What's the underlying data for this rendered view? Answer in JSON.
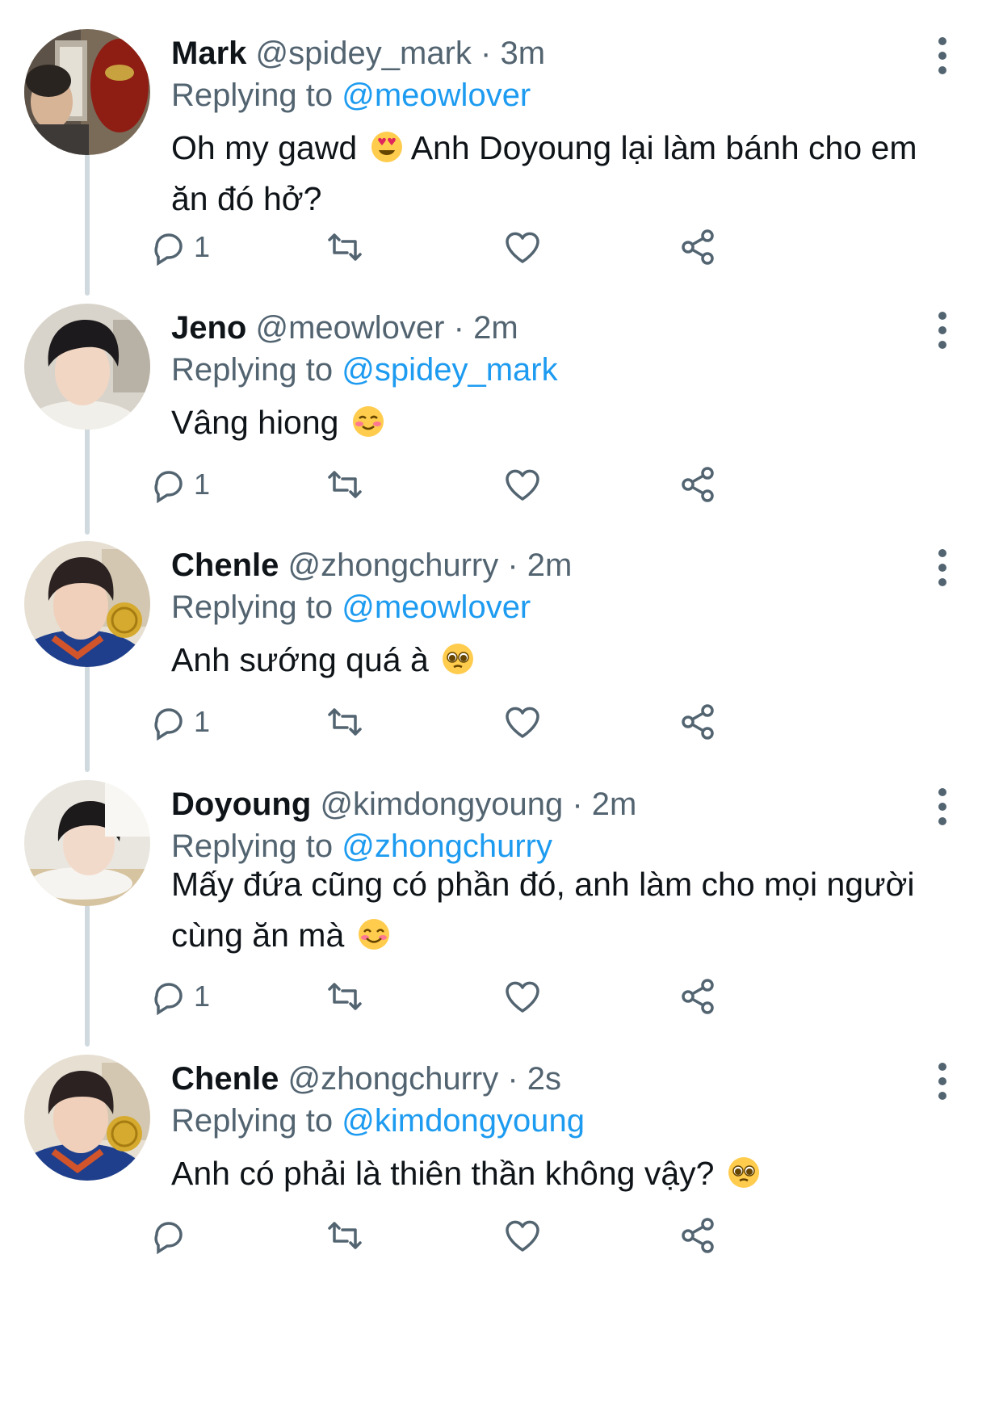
{
  "tweets": [
    {
      "name": "Mark",
      "handle": "@spidey_mark",
      "time": "3m",
      "replying_label": "Replying to",
      "replying_to": "@meowlover",
      "text": "Oh my gawd",
      "emoji": "heart-eyes",
      "text_after": "Anh Doyoung lại làm bánh cho em ăn đó hở?",
      "reply_count": "1"
    },
    {
      "name": "Jeno",
      "handle": "@meowlover",
      "time": "2m",
      "replying_label": "Replying to",
      "replying_to": "@spidey_mark",
      "text": "Vâng hiong",
      "emoji": "smiling-blush",
      "text_after": "",
      "reply_count": "1"
    },
    {
      "name": "Chenle",
      "handle": "@zhongchurry",
      "time": "2m",
      "replying_label": "Replying to",
      "replying_to": "@meowlover",
      "text": "Anh sướng quá à",
      "emoji": "pleading",
      "text_after": "",
      "reply_count": "1"
    },
    {
      "name": "Doyoung",
      "handle": "@kimdongyoung",
      "time": "2m",
      "replying_label": "Replying to",
      "replying_to": "@zhongchurry",
      "text": "Mấy đứa cũng có phần đó, anh làm cho mọi người cùng ăn mà",
      "emoji": "smiling",
      "text_after": "",
      "reply_count": "1"
    },
    {
      "name": "Chenle",
      "handle": "@zhongchurry",
      "time": "2s",
      "replying_label": "Replying to",
      "replying_to": "@kimdongyoung",
      "text": "Anh có phải là thiên thần không vậy?",
      "emoji": "pleading",
      "text_after": "",
      "reply_count": ""
    }
  ],
  "sep": "·",
  "colors": {
    "mention": "#1d9bf0",
    "muted": "#536471",
    "thread_line": "#cfd9de"
  },
  "icons": {
    "reply": "comment-bubble-icon",
    "retweet": "retweet-icon",
    "like": "heart-icon",
    "share": "share-icon",
    "more": "more-vertical-icon"
  }
}
